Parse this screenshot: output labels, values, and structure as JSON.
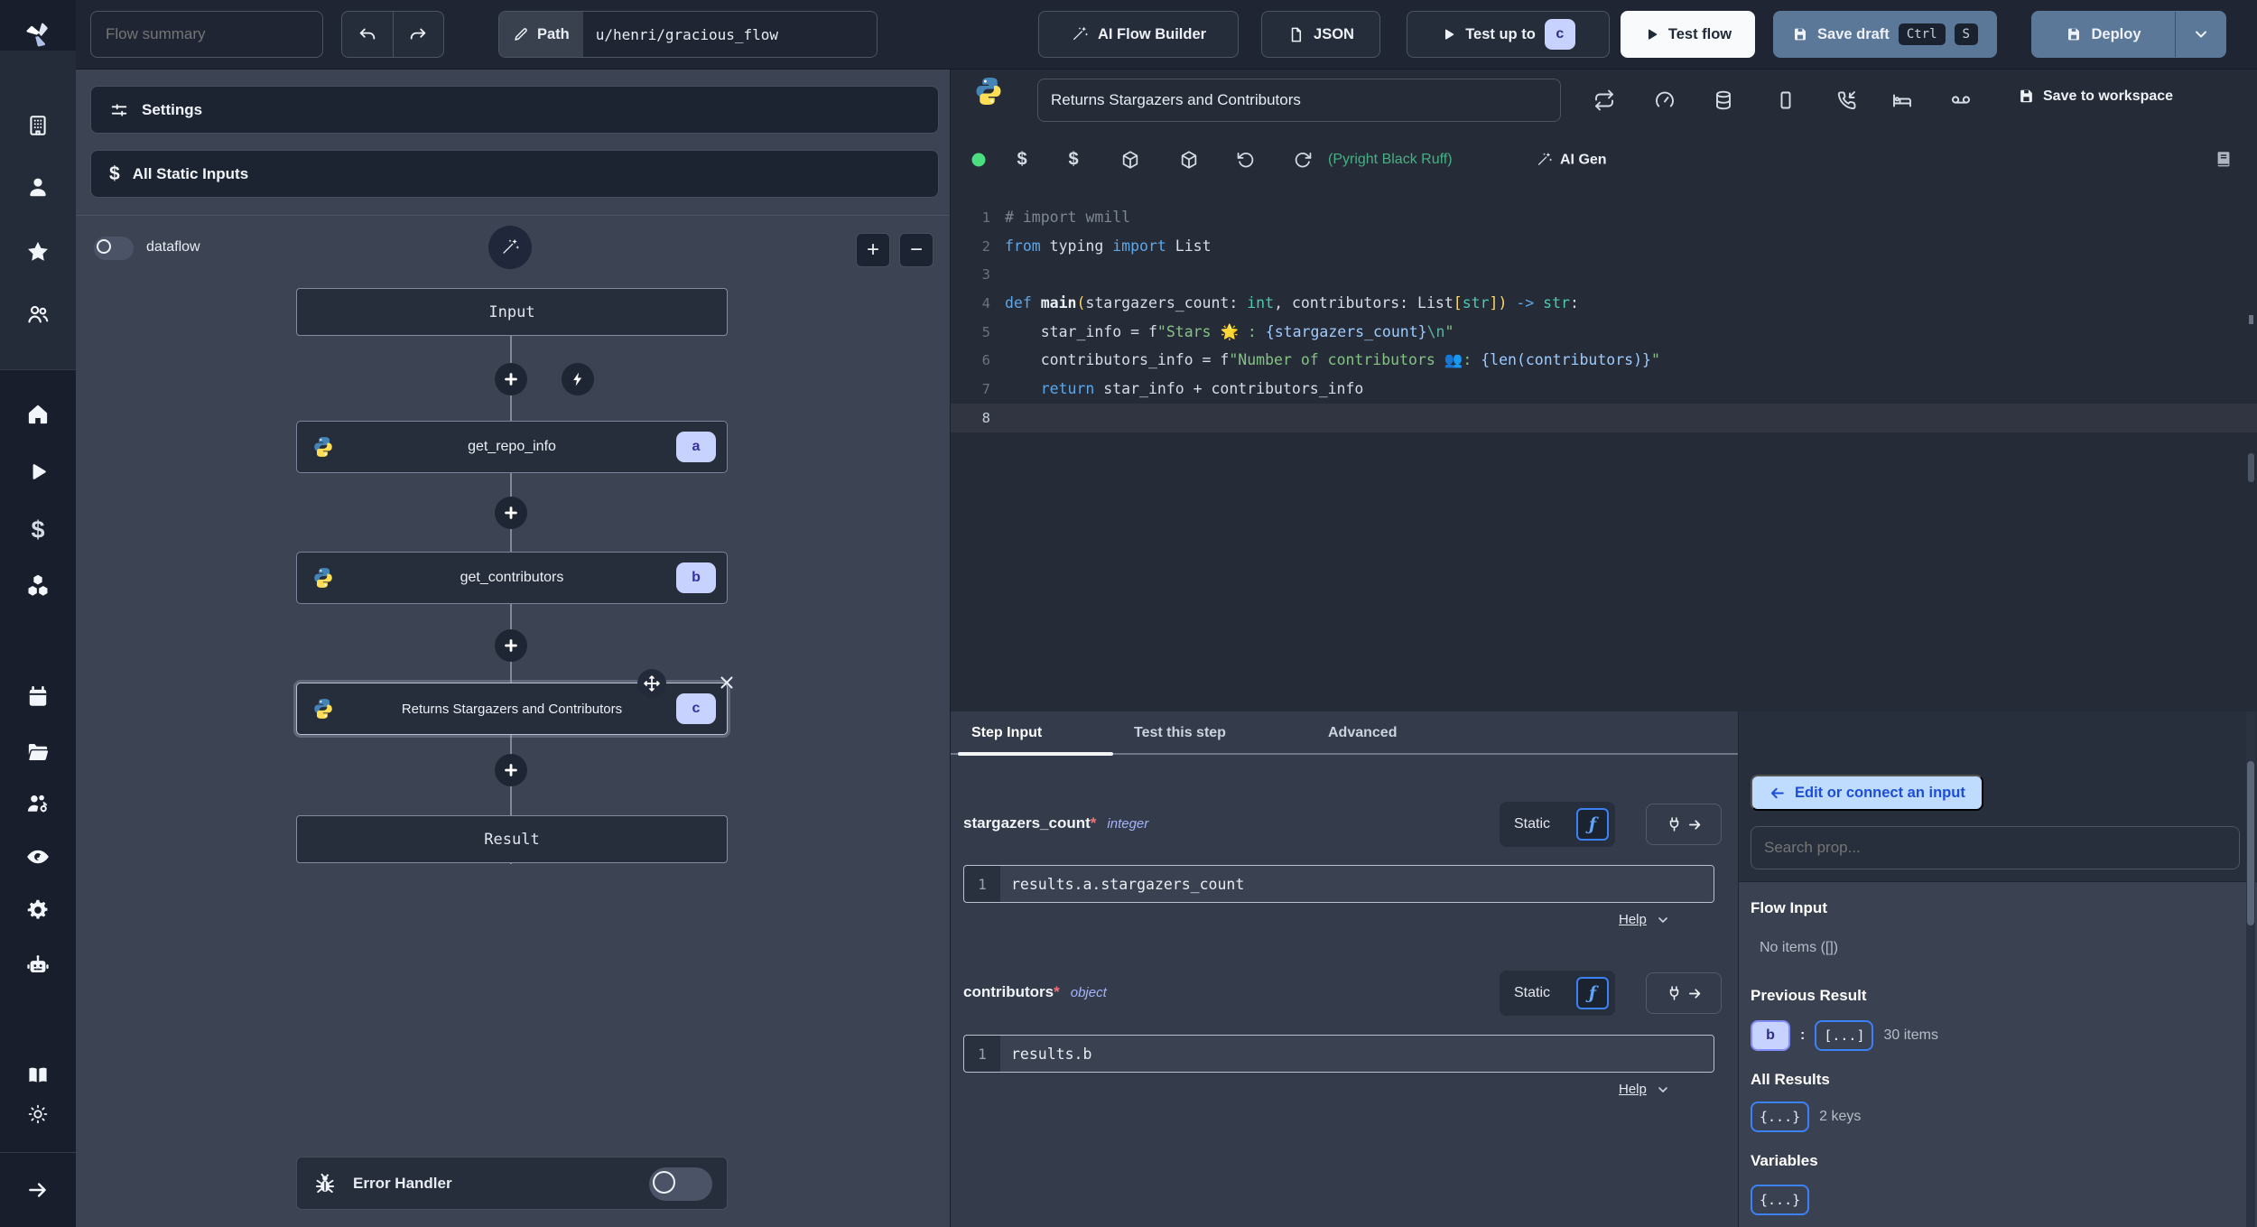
{
  "topbar": {
    "flow_summary_placeholder": "Flow summary",
    "path_label": "Path",
    "path_value": "u/henri/gracious_flow",
    "ai_flow_builder": "AI Flow Builder",
    "json_button": "JSON",
    "test_up_to": "Test up to",
    "test_up_to_badge": "c",
    "test_flow": "Test flow",
    "save_draft": "Save draft",
    "kbd_ctrl": "Ctrl",
    "kbd_s": "S",
    "deploy": "Deploy"
  },
  "sidebar": {
    "icons_top": [
      "building-icon",
      "user-icon",
      "star-icon",
      "users-icon"
    ],
    "icons_main": [
      "home-icon",
      "play-icon",
      "dollar-icon",
      "cubes-icon",
      "calendar-icon",
      "folder-icon",
      "users-gear-icon",
      "eye-icon",
      "gear-icon",
      "robot-icon"
    ],
    "icons_bottom": [
      "book-icon",
      "sun-icon",
      "arrow-right-icon"
    ]
  },
  "flow_panel": {
    "settings": "Settings",
    "all_static_inputs": "All Static Inputs",
    "dataflow_label": "dataflow",
    "dataflow_on": false,
    "zoom_in": "+",
    "zoom_out": "−",
    "input_node": "Input",
    "result_node": "Result",
    "steps": [
      {
        "name": "get_repo_info",
        "badge": "a"
      },
      {
        "name": "get_contributors",
        "badge": "b"
      },
      {
        "name": "Returns Stargazers and Contributors",
        "badge": "c"
      }
    ],
    "selected_step": "c",
    "error_handler": "Error Handler"
  },
  "editor": {
    "language": "python",
    "title": "Returns Stargazers and Contributors",
    "save_to_workspace": "Save to workspace",
    "lint_text": "(Pyright Black Ruff)",
    "ai_gen": "AI Gen",
    "status_dot_color": "#4ade80",
    "header_icons": [
      "retry-icon",
      "gauge-icon",
      "database-icon",
      "mobile-icon",
      "phone-incoming-icon",
      "sleep-icon",
      "voicemail-icon",
      "save-icon"
    ],
    "toolbar_icons": [
      "status-dot-icon",
      "dollar-icon",
      "dollar-icon",
      "package-icon",
      "package-icon",
      "rotate-ccw-icon",
      "refresh-icon",
      "wand-icon",
      "book-icon"
    ],
    "code": {
      "active_line": 8,
      "lines": [
        {
          "n": 1,
          "t": [
            [
              "cm",
              "# import wmill"
            ]
          ]
        },
        {
          "n": 2,
          "t": [
            [
              "kw",
              "from"
            ],
            [
              "pl",
              " typing "
            ],
            [
              "kw",
              "import"
            ],
            [
              "pl",
              " List"
            ]
          ]
        },
        {
          "n": 3,
          "t": []
        },
        {
          "n": 4,
          "t": [
            [
              "kw",
              "def"
            ],
            [
              "fn",
              " main"
            ],
            [
              "br",
              "("
            ],
            [
              "pl",
              "stargazers_count"
            ],
            [
              "pl",
              ": "
            ],
            [
              "ty",
              "int"
            ],
            [
              "pl",
              ", "
            ],
            [
              "pl",
              "contributors"
            ],
            [
              "pl",
              ": "
            ],
            [
              "pl",
              "List"
            ],
            [
              "br",
              "["
            ],
            [
              "ty",
              "str"
            ],
            [
              "br",
              "]"
            ],
            [
              "br",
              ")"
            ],
            [
              "pl",
              " "
            ],
            [
              "kw",
              "->"
            ],
            [
              "pl",
              " "
            ],
            [
              "ty",
              "str"
            ],
            [
              "pl",
              ":"
            ]
          ]
        },
        {
          "n": 5,
          "t": [
            [
              "pl",
              "    star_info = f"
            ],
            [
              "st",
              "\"Stars "
            ],
            [
              "pl",
              "🌟"
            ],
            [
              "st",
              " : "
            ],
            [
              "ip",
              "{stargazers_count}"
            ],
            [
              "esc",
              "\\n"
            ],
            [
              "st",
              "\""
            ]
          ]
        },
        {
          "n": 6,
          "t": [
            [
              "pl",
              "    contributors_info = f"
            ],
            [
              "st",
              "\"Number of contributors "
            ],
            [
              "pl",
              "👥"
            ],
            [
              "st",
              ": "
            ],
            [
              "ip",
              "{len(contributors)}"
            ],
            [
              "st",
              "\""
            ]
          ]
        },
        {
          "n": 7,
          "t": [
            [
              "kw",
              "    return"
            ],
            [
              "pl",
              " star_info + contributors_info"
            ]
          ]
        },
        {
          "n": 8,
          "t": []
        }
      ]
    }
  },
  "step_panel": {
    "tabs": [
      {
        "label": "Step Input"
      },
      {
        "label": "Test this step"
      },
      {
        "label": "Advanced"
      }
    ],
    "active_tab": "Step Input",
    "params": [
      {
        "name": "stargazers_count",
        "required": "*",
        "type": "integer",
        "mode": "Static",
        "line_no": "1",
        "expr": "results.a.stargazers_count",
        "help": "Help"
      },
      {
        "name": "contributors",
        "required": "*",
        "type": "object",
        "mode": "Static",
        "line_no": "1",
        "expr": "results.b",
        "help": "Help"
      }
    ]
  },
  "props_panel": {
    "edit_connect": "Edit or connect an input",
    "search_placeholder": "Search prop...",
    "flow_input": {
      "title": "Flow Input",
      "empty": "No items ([])"
    },
    "previous_result": {
      "title": "Previous Result",
      "badge": "b",
      "colon": ":",
      "array_badge": "[...]",
      "count": "30 items"
    },
    "all_results": {
      "title": "All Results",
      "badge": "{...}",
      "count": "2 keys"
    },
    "variables": {
      "title": "Variables",
      "badge": "{...}"
    }
  }
}
